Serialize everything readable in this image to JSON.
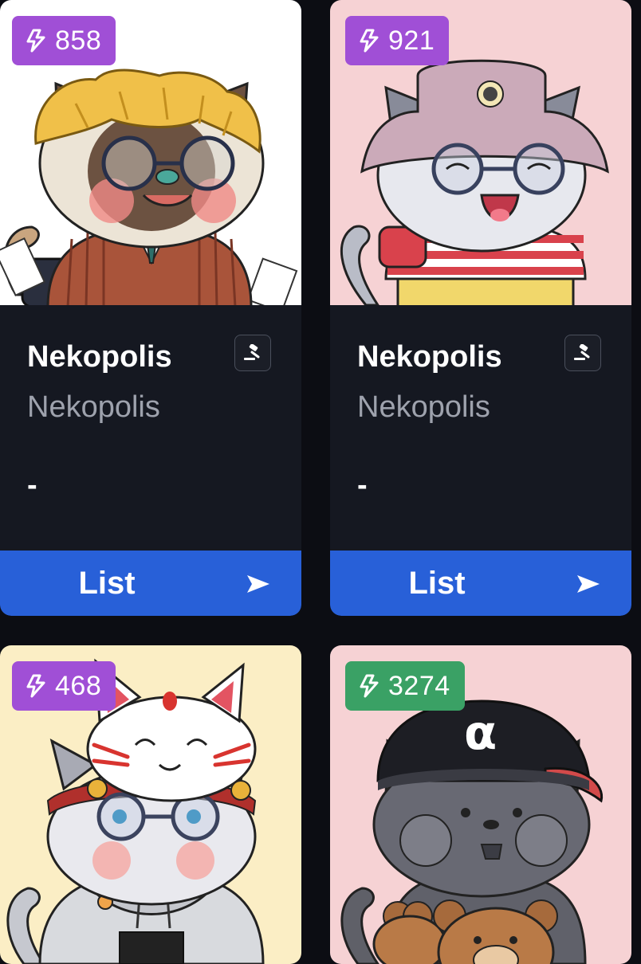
{
  "cards": [
    {
      "badge": "858",
      "badge_color": "#a04fd6",
      "title": "Nekopolis",
      "collection": "Nekopolis",
      "price": "-",
      "action": "List",
      "bg": "#ffffff"
    },
    {
      "badge": "921",
      "badge_color": "#a04fd6",
      "title": "Nekopolis",
      "collection": "Nekopolis",
      "price": "-",
      "action": "List",
      "bg": "#f6d2d4"
    },
    {
      "badge": "468",
      "badge_color": "#a04fd6",
      "bg": "#fbeec5"
    },
    {
      "badge": "3274",
      "badge_color": "#3aa165",
      "bg": "#f6d2d4"
    }
  ],
  "icons": {
    "badge": "lightning-bolt-icon",
    "auction": "gavel-icon",
    "list": "send-arrow-icon"
  }
}
